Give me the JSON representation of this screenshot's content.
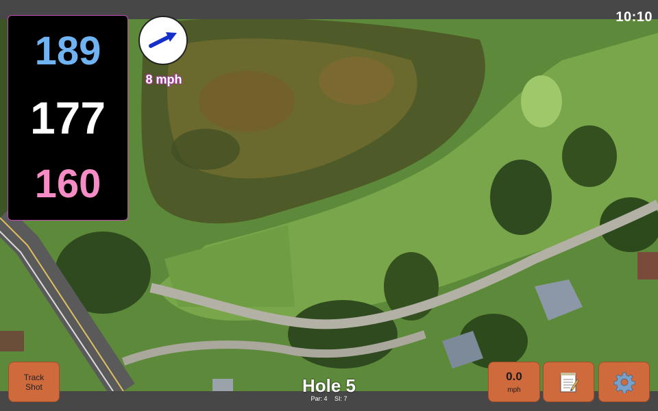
{
  "clock": "10:10",
  "yardages": {
    "back": "189",
    "middle": "177",
    "front": "160"
  },
  "wind": {
    "speed": "8 mph",
    "icon": "wind-arrow-icon"
  },
  "buttons": {
    "track_shot": "Track\nShot",
    "speed_value": "0.0",
    "speed_unit": "mph",
    "notes_icon": "notepad-icon",
    "settings_icon": "gear-icon"
  },
  "hole": {
    "title": "Hole 5",
    "par": "Par: 4",
    "si": "SI: 7"
  },
  "colors": {
    "back_yardage": "#6fb3f3",
    "middle_yardage": "#ffffff",
    "front_yardage": "#f58cc5",
    "button_bg": "#cf6a3d",
    "wind_label": "#a43a9a"
  }
}
